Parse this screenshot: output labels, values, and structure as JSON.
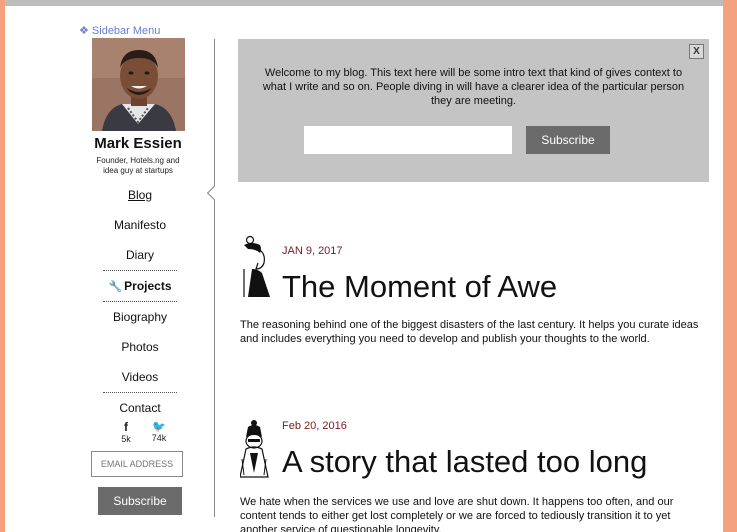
{
  "sidebar": {
    "menu_link": "❖ Sidebar Menu",
    "author_name": "Mark Essien",
    "author_bio": "Founder, Hotels.ng and idea guy at  startups",
    "nav": [
      {
        "label": "Blog"
      },
      {
        "label": "Manifesto"
      },
      {
        "label": "Diary"
      },
      {
        "label": "Projects"
      },
      {
        "label": "Biography"
      },
      {
        "label": "Photos"
      },
      {
        "label": "Videos"
      },
      {
        "label": "Contact"
      }
    ],
    "social": [
      {
        "icon": "facebook-icon",
        "glyph": "f",
        "count": "5k"
      },
      {
        "icon": "twitter-icon",
        "glyph": "🐦",
        "count": "74k"
      }
    ],
    "email_placeholder": "EMAIL ADDRESS",
    "subscribe_label": "Subscribe"
  },
  "intro": {
    "close_label": "X",
    "text": "Welcome to my blog. This text here will be some intro text that kind of gives context to what I write and so on. People diving in will have a clearer idea of the particular person they are meeting.",
    "input_value": "",
    "subscribe_label": "Subscribe"
  },
  "posts": [
    {
      "date": "JAN 9, 2017",
      "title": "The Moment of Awe",
      "excerpt": "The reasoning behind one of the biggest disasters of the last century. It helps you curate ideas and includes everything you need to develop and publish your thoughts to the world."
    },
    {
      "date": "Feb 20, 2016",
      "title": "A story that lasted too long",
      "excerpt": "We hate when the services we use and love are shut down. It happens too often, and our content tends to either get lost completely or we are forced to tediously transition it to yet another service of questionable longevity."
    }
  ],
  "colors": {
    "page_bg": "#f4a27e",
    "intro_bg": "#c4c4c4",
    "button_bg": "#6b6b6b",
    "date_color": "#7a1b1b",
    "menu_link_color": "#6a7bd8"
  }
}
